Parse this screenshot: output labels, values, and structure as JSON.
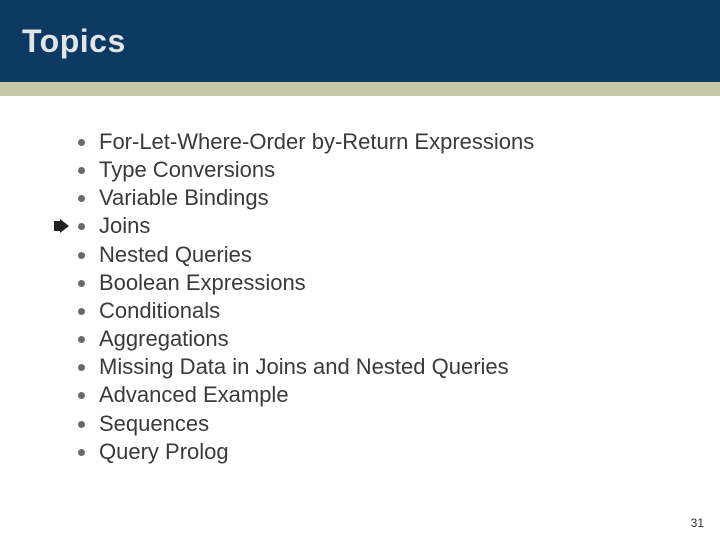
{
  "slide": {
    "title": "Topics",
    "page_number": "31",
    "current_index": 3,
    "items": [
      "For-Let-Where-Order by-Return Expressions",
      "Type Conversions",
      "Variable Bindings",
      "Joins",
      "Nested Queries",
      "Boolean Expressions",
      "Conditionals",
      "Aggregations",
      "Missing Data in Joins and Nested Queries",
      "Advanced Example",
      "Sequences",
      "Query Prolog"
    ]
  }
}
